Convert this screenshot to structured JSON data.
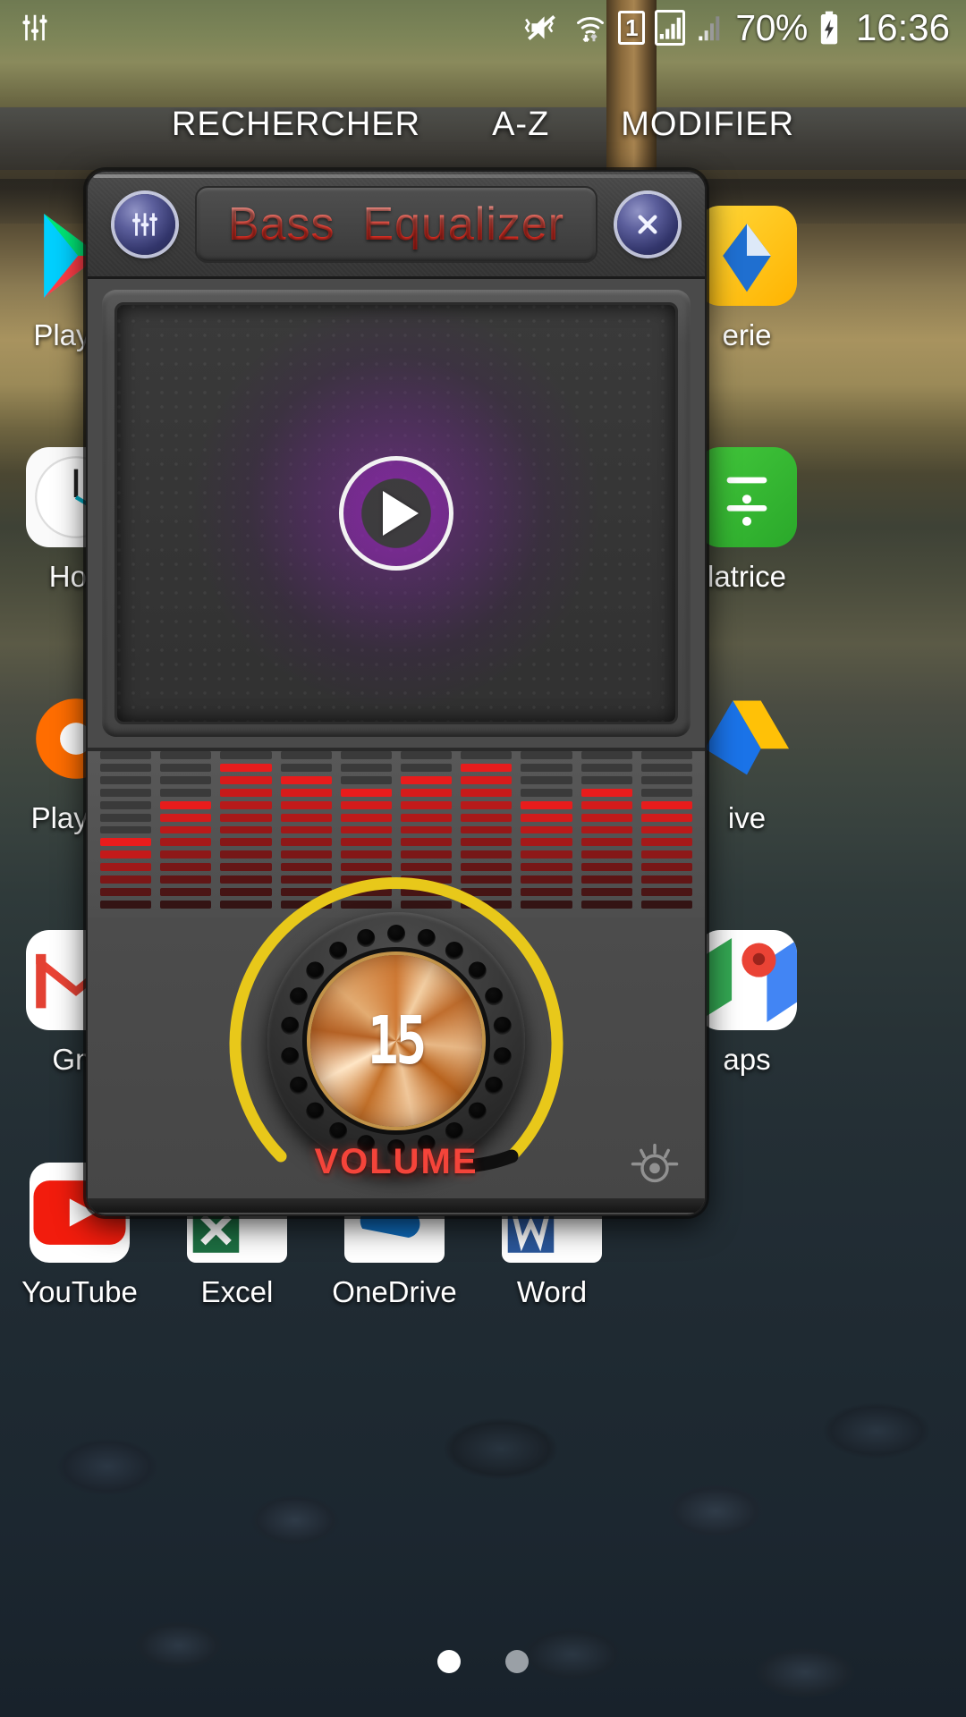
{
  "statusbar": {
    "left_icon": "equalizer-sliders-icon",
    "icons": [
      "vibrate-mute-icon",
      "wifi-transfer-icon",
      "sim-1-icon",
      "signal-boxed-icon",
      "signal-bars-icon"
    ],
    "sim_label": "1",
    "battery_percent": "70%",
    "battery_state_icon": "battery-charging-icon",
    "clock": "16:36"
  },
  "homescreen": {
    "actions": [
      "RECHERCHER",
      "A-Z",
      "MODIFIER"
    ],
    "icons": [
      {
        "name": "play-store",
        "label": "Play S"
      },
      {
        "name": "galerie",
        "label": "erie"
      },
      {
        "name": "horloge",
        "label": "Horl"
      },
      {
        "name": "calculatrice",
        "label": "latrice"
      },
      {
        "name": "play-music",
        "label": "Play M"
      },
      {
        "name": "drive",
        "label": "ive"
      },
      {
        "name": "gmail",
        "label": "Gm"
      },
      {
        "name": "maps",
        "label": "aps"
      },
      {
        "name": "youtube",
        "label": "YouTube"
      },
      {
        "name": "excel",
        "label": "Excel"
      },
      {
        "name": "onedrive",
        "label": "OneDrive"
      },
      {
        "name": "word",
        "label": "Word"
      }
    ],
    "page_indicator": {
      "total": 2,
      "active": 1
    }
  },
  "app": {
    "title": "Bass  Equalizer",
    "settings_icon": "equalizer-sliders-icon",
    "close_icon": "close-x-icon",
    "player": {
      "play_icon": "play-triangle-icon",
      "state": "paused"
    },
    "spectrum": {
      "label": "spectrum-analyzer",
      "bars": [
        6,
        9,
        12,
        11,
        10,
        11,
        12,
        9,
        10,
        9
      ],
      "max": 13,
      "color": "#e81c1c"
    },
    "volume": {
      "label": "VOLUME",
      "value": "15",
      "min": 0,
      "max": 30,
      "arc_color": "#e8c81a",
      "knob_color": "#d4822f"
    },
    "footer_icon": "gear-icon"
  },
  "colors": {
    "accent_red": "#f4443a",
    "title_red": "#f5392c",
    "knob_yellow": "#e8c81a",
    "button_blue": "#5c5f9c",
    "panel_gray": "#4a4a4a"
  }
}
